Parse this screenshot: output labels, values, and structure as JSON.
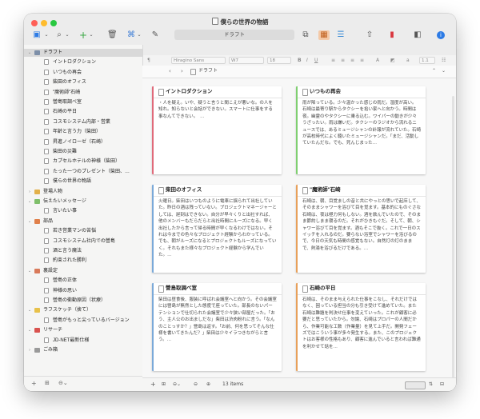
{
  "window": {
    "title": "僕らの世界の物語"
  },
  "toolbar": {
    "current_doc": "ドラフト"
  },
  "formatbar": {
    "style_value": "¶",
    "font_name": "Hiragino Sans",
    "font_weight": "W7",
    "font_size": "18",
    "line_spacing": "1.1"
  },
  "navbar": {
    "path": "ドラフト"
  },
  "sidebar": {
    "items": [
      {
        "label": "ドラフト",
        "level": 0,
        "type": "folder",
        "expanded": true,
        "selected": true,
        "color": "#7d8fa8"
      },
      {
        "label": "イントロダクション",
        "level": 1,
        "type": "doc"
      },
      {
        "label": "いつもの再会",
        "level": 1,
        "type": "doc"
      },
      {
        "label": "柴田のオフィス",
        "level": 1,
        "type": "doc"
      },
      {
        "label": "\"魔術師\"石崎",
        "level": 1,
        "type": "doc"
      },
      {
        "label": "營島取調べ室",
        "level": 1,
        "type": "doc"
      },
      {
        "label": "石崎の平日",
        "level": 1,
        "type": "doc"
      },
      {
        "label": "コスモシステム内部・営業",
        "level": 1,
        "type": "doc"
      },
      {
        "label": "年齢と言う力（柴田）",
        "level": 1,
        "type": "doc"
      },
      {
        "label": "昇進ノイローゼ（石崎）",
        "level": 1,
        "type": "doc"
      },
      {
        "label": "柴田の災難",
        "level": 1,
        "type": "doc"
      },
      {
        "label": "カプセルホテルの神様（柴田）",
        "level": 1,
        "type": "doc"
      },
      {
        "label": "たった一つのプレゼント（柴田、…",
        "level": 1,
        "type": "doc"
      },
      {
        "label": "僕らの世界の物語",
        "level": 1,
        "type": "doc"
      },
      {
        "label": "登場人物",
        "level": 0,
        "type": "folder",
        "color": "#e2b04a"
      },
      {
        "label": "伝えたいメッセージ",
        "level": 0,
        "type": "folder",
        "expanded": true,
        "color": "#7fbf6a"
      },
      {
        "label": "言いたい事",
        "level": 1,
        "type": "doc"
      },
      {
        "label": "部品",
        "level": 0,
        "type": "folder",
        "expanded": true,
        "color": "#e0804a"
      },
      {
        "label": "若き営業マンの苦悩",
        "level": 1,
        "type": "doc"
      },
      {
        "label": "コスモシステム社内での營島",
        "level": 1,
        "type": "doc"
      },
      {
        "label": "酒と言う魔法",
        "level": 1,
        "type": "doc"
      },
      {
        "label": "約束された勝利",
        "level": 1,
        "type": "doc"
      },
      {
        "label": "裏設定",
        "level": 0,
        "type": "folder",
        "expanded": true,
        "color": "#d97a5a"
      },
      {
        "label": "營島の正体",
        "level": 1,
        "type": "doc"
      },
      {
        "label": "神様の思い",
        "level": 1,
        "type": "doc"
      },
      {
        "label": "營島の衝動原因（状療）",
        "level": 1,
        "type": "doc"
      },
      {
        "label": "ラフスケッチ（捨て）",
        "level": 0,
        "type": "folder",
        "expanded": true,
        "color": "#e8c14a"
      },
      {
        "label": "營島がもっと尖っているバージョン",
        "level": 1,
        "type": "doc"
      },
      {
        "label": "リサーチ",
        "level": 0,
        "type": "folder",
        "expanded": true,
        "color": "#d9534f"
      },
      {
        "label": "JD-NET最新仕様",
        "level": 1,
        "type": "doc"
      },
      {
        "label": "ごみ箱",
        "level": 0,
        "type": "folder",
        "color": "#9a9a9a"
      }
    ]
  },
  "cards": [
    {
      "title": "イントロダクション",
      "color": "#e06a7a",
      "body": "・人を疑え。いや、疑うと言うと聞こえが悪いな。の人を知れ。知らないと会話ができない。スマートに仕事をする事なんてできない。　…"
    },
    {
      "title": "いつもの再会",
      "color": "#7fcf70",
      "body": "雨が降っている。少々温かった感じの雨だ。湿度が高い。石崎は最寄り駅からタクシーを拾い家へと向かう。時間は夜。幽霊のやタクシーに乗る込む。ワイパーの動きが少々うざったい。雨は嫌いだ。タクシーのラジオから流れるニュースでは、あるミュージシャンの訃報が流れていた。石崎が高校時代によく聴いたミュージシャンだ。「まだ、活動していたんだな。でも、死んじまった…"
    },
    {
      "title": "柴田のオフィス",
      "color": "#7aa9d9",
      "body": "火曜日。柴田はいつものように電車に揺られて出社していた。昨日の酒は残っていない。プロジェクトマネージャーとしては、遅刻はできない。自分が早々くりと出社すれば、他のメンバーもだらだらと出社時間にルーズになる。早く出社したから言って帰る時間が早くなるわけではない。それは今までの色々なプロジェクト経験からわかっている。でも、朝がルーズになるとプロジェクトもルーズになっていく。それもまた様々なプロジェクト経験から学んでいた。…"
    },
    {
      "title": "\"魔術師\"石崎",
      "color": "#e8a05a",
      "body": "石崎は、朝、目覚ましの音と共にやっとの思いで起床して、そのままシャワーを浴びて目を覚ます。基本的にものぐさな石崎は、夜は極力何もしない。酒を飲んでいたので、そのまま節約しまま寝るのだ。それがひきもぐだ。そして、朝、シャワー浴びて目を覚ます。酒もそこで抜く。これで一日のスイッチを入れるのだ。要らない浴室でシャワーを浴びるので、今日の天気も時間の感覚もない。自然灯の灯のままで、熱湯を浴びるだけである。…"
    },
    {
      "title": "營島取調べ室",
      "color": "#7aa9d9",
      "body": "柴田は昼食後、服装に呼ばれ会議室へと向かう。その会議室には營島が無然とした態度で座っていた。部長のないパーテンションで仕切られた会議室で少々狭い部屋だった。「おう、主人公のお出ましだな」柴田は渋肉粉れに言う。「なんのことっすか？」營島は返す。「お前、何を思ってそんな仕様を書いてきたんだ？」柴田は少々イラつきながらと言う。…"
    },
    {
      "title": "石崎の平日",
      "color": "#e8a05a",
      "body": "石崎は、そのまま与えられた仕事をこなし、それだけではなく、困っている担当の分も引き受けて進めていた。また石崎は難題を判決せ仕事を変えていった。これが顧客に必要だと思っていたから。勿論、石崎はプロパーの人間だから、作業可能な工数（作業量）を見て上手だ。開発フェーズではこういう事が多々発生する。また、このプロジェクトはお客様の性格もあり、顧客に進んでいると言われば難通を利かせて話を…"
    }
  ],
  "status": {
    "items_count": "13 items"
  }
}
